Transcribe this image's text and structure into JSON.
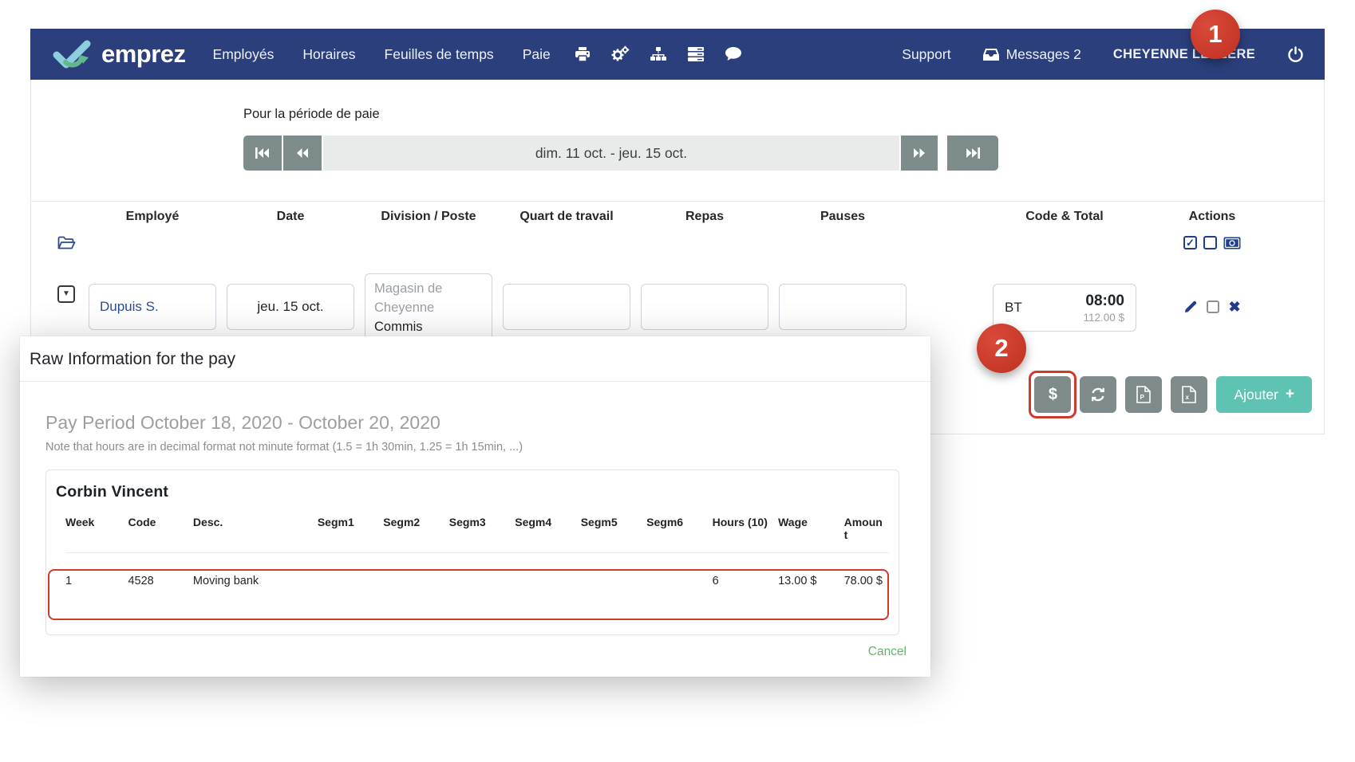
{
  "navbar": {
    "brand": "emprez",
    "items": [
      {
        "label": "Employés"
      },
      {
        "label": "Horaires"
      },
      {
        "label": "Feuilles de temps"
      },
      {
        "label": "Paie"
      }
    ],
    "support_label": "Support",
    "messages_label": "Messages 2",
    "user_name": "CHEYENNE LECLERE"
  },
  "annotations": {
    "badge1": "1",
    "badge2": "2"
  },
  "period_selector": {
    "label": "Pour la période de paie",
    "value": "dim. 11 oct. - jeu. 15 oct."
  },
  "main_table": {
    "columns": [
      "Employé",
      "Date",
      "Division / Poste",
      "Quart de travail",
      "Repas",
      "Pauses",
      "Code & Total",
      "Actions"
    ],
    "row": {
      "employee": "Dupuis S.",
      "date": "jeu. 15 oct.",
      "division_line1": "Magasin de",
      "division_line2": "Cheyenne",
      "poste": "Commis",
      "code": "BT",
      "total_time": "08:00",
      "total_amount": "112.00 $",
      "delete_glyph": "✖"
    },
    "header_check_glyph": "✓"
  },
  "toolbar": {
    "dollar_label": "$",
    "add_label": "Ajouter",
    "add_plus": "+"
  },
  "modal": {
    "title": "Raw Information for the pay",
    "period_heading": "Pay Period October 18, 2020 - October 20, 2020",
    "note": "Note that hours are in decimal format not minute format (1.5 = 1h 30min, 1.25 = 1h 15min, ...)",
    "employee_name": "Corbin Vincent",
    "table": {
      "headers": [
        "Week",
        "Code",
        "Desc.",
        "Segm1",
        "Segm2",
        "Segm3",
        "Segm4",
        "Segm5",
        "Segm6",
        "Hours (10)",
        "Wage",
        "Amount"
      ],
      "row": [
        "1",
        "4528",
        "Moving bank",
        "",
        "",
        "",
        "",
        "",
        "",
        "6",
        "13.00 $",
        "78.00 $"
      ]
    },
    "cancel_label": "Cancel"
  },
  "colors": {
    "navbar_bg": "#2b3f7c",
    "annotation_red": "#cd3a2e",
    "button_gray": "#7f8a8b",
    "add_teal": "#5ec3b3",
    "link_blue": "#2a4a9e",
    "cancel_green": "#63b56a"
  }
}
